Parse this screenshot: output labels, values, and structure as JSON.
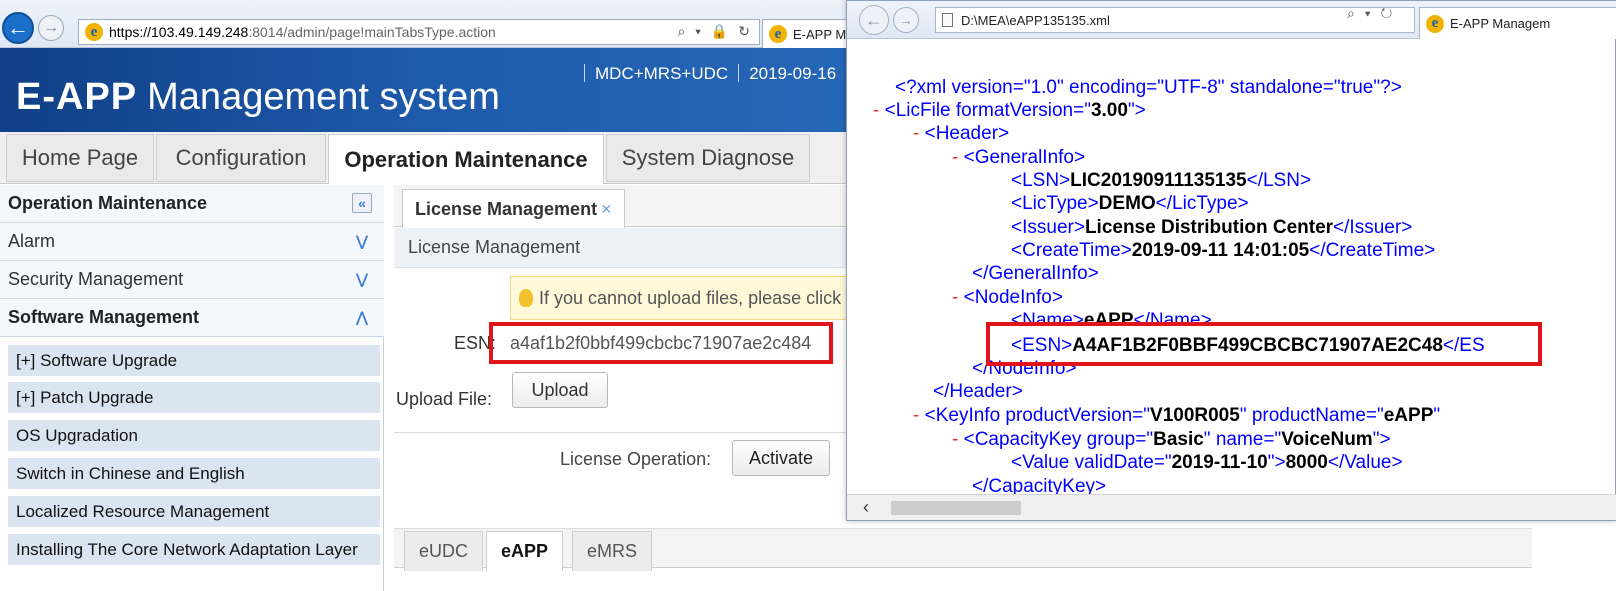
{
  "browser": {
    "url_host": "https://103.49.149.248",
    "url_rest": ":8014/admin/page!mainTabsType.action",
    "controls": "⌕ ▾ 🔒 ↻",
    "tab_title": "E-APP M"
  },
  "header": {
    "brand": "E-APP",
    "title": "Management system",
    "modes": "MDC+MRS+UDC",
    "date": "2019-09-16"
  },
  "main_tabs": [
    "Home Page",
    "Configuration",
    "Operation Maintenance",
    "System Diagnose"
  ],
  "sidebar": {
    "section_title": "Operation Maintenance",
    "groups": [
      "Alarm",
      "Security Management",
      "Software Management"
    ],
    "items": [
      "[+] Software Upgrade",
      "[+] Patch Upgrade",
      "OS Upgradation",
      "Switch in Chinese and English",
      "Localized Resource Management",
      "Installing The Core Network Adaptation Layer"
    ]
  },
  "content": {
    "tab_label": "License Management",
    "tab_close": "×",
    "panel_title": "License Management",
    "tip": "If you cannot upload files, please click",
    "esn_label": "ESN:",
    "esn_value": "a4af1b2f0bbf499cbcbc71907ae2c484",
    "upload_label": "Upload File:",
    "upload_button": "Upload",
    "op_label": "License Operation:",
    "activate_button": "Activate",
    "product_tabs": [
      "eUDC",
      "eAPP",
      "eMRS"
    ],
    "active_product": "eAPP"
  },
  "xml_viewer": {
    "address": "D:\\MEA\\eAPP135135.xml",
    "controls": "⌕ ▾ ↻",
    "tab_title": "E-APP Managem",
    "lines": {
      "decl": "<?xml version=\"1.0\" encoding=\"UTF-8\" standalone=\"true\"?>",
      "licfile_open": "<LicFile formatVersion=\"",
      "format_version": "3.00",
      "licfile_end": "\">",
      "header_open": "<Header>",
      "general_open": "<GeneralInfo>",
      "lsn_open": "<LSN>",
      "lsn": "LIC20190911135135",
      "lsn_close": "</LSN>",
      "lictype_open": "<LicType>",
      "lictype": "DEMO",
      "lictype_close": "</LicType>",
      "issuer_open": "<Issuer>",
      "issuer": "License Distribution Center",
      "issuer_close": "</Issuer>",
      "createtime_open": "<CreateTime>",
      "createtime": "2019-09-11 14:01:05",
      "createtime_close": "</CreateTime>",
      "general_close": "</GeneralInfo>",
      "node_open": "<NodeInfo>",
      "name_open": "<Name>",
      "name": "eAPP",
      "name_close": "</Name>",
      "esn_open": "<ESN>",
      "esn": "A4AF1B2F0BBF499CBCBC71907AE2C48",
      "esn_close": "</ES",
      "node_close": "</NodeInfo>",
      "header_close": "</Header>",
      "keyinfo_open": "<KeyInfo productVersion=\"",
      "product_version": "V100R005",
      "keyinfo_mid": "\" productName=\"",
      "product_name": "eAPP",
      "keyinfo_end": "\"",
      "capacity_open": "<CapacityKey group=\"",
      "capacity_group": "Basic",
      "capacity_mid": "\" name=\"",
      "capacity_name": "VoiceNum",
      "capacity_end": "\">",
      "value_open": "<Value validDate=\"",
      "valid_date": "2019-11-10",
      "value_mid": "\">",
      "value": "8000",
      "value_close": "</Value>",
      "capacity_close": "</CapacityKey>"
    },
    "minus": "-"
  },
  "colors": {
    "header_blue": "#1f5bac",
    "xml_tag": "#0000ff",
    "xml_minus": "#e0323a",
    "highlight_box": "#e0141a",
    "sidebar_item_bg": "#dbe5f1"
  }
}
